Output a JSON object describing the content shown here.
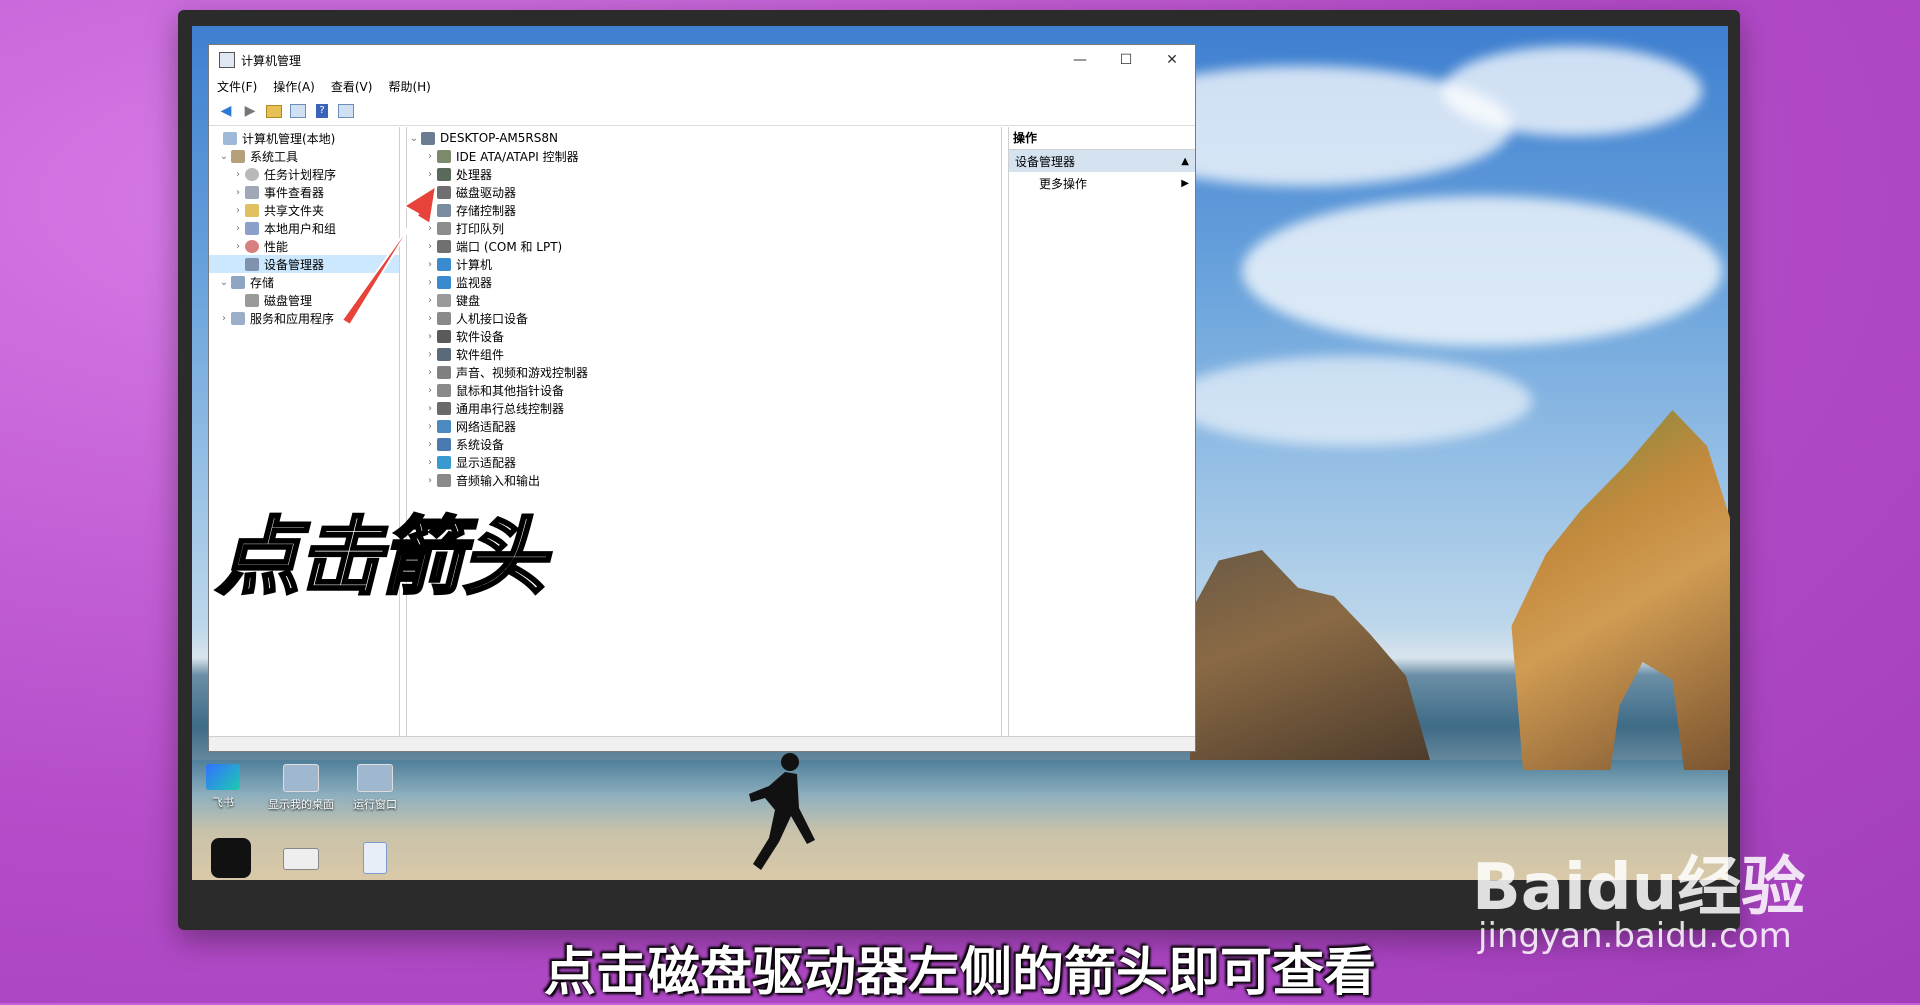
{
  "window": {
    "title": "计算机管理",
    "menu": [
      "文件(F)",
      "操作(A)",
      "查看(V)",
      "帮助(H)"
    ],
    "minimize_glyph": "—",
    "maximize_glyph": "☐",
    "close_glyph": "✕"
  },
  "tree": {
    "root": "计算机管理(本地)",
    "system_tools": "系统工具",
    "items": [
      "任务计划程序",
      "事件查看器",
      "共享文件夹",
      "本地用户和组",
      "性能",
      "设备管理器"
    ],
    "storage": "存储",
    "disk_mgmt": "磁盘管理",
    "services": "服务和应用程序"
  },
  "devices": {
    "computer_name": "DESKTOP-AM5RS8N",
    "categories": [
      "IDE ATA/ATAPI 控制器",
      "处理器",
      "磁盘驱动器",
      "存储控制器",
      "打印队列",
      "端口 (COM 和 LPT)",
      "计算机",
      "监视器",
      "键盘",
      "人机接口设备",
      "软件设备",
      "软件组件",
      "声音、视频和游戏控制器",
      "鼠标和其他指针设备",
      "通用串行总线控制器",
      "网络适配器",
      "系统设备",
      "显示适配器",
      "音频输入和输出"
    ]
  },
  "actions": {
    "header": "操作",
    "section": "设备管理器",
    "more": "更多操作"
  },
  "desktop_icons": [
    "飞书",
    "显示我的桌面",
    "运行窗口"
  ],
  "overlay": {
    "big_text": "点击箭头",
    "caption": "点击磁盘驱动器左侧的箭头即可查看"
  },
  "watermark": {
    "brand": "Baidu经验",
    "url": "jingyan.baidu.com"
  },
  "colors": {
    "selection": "#cce8ff",
    "arrow": "#e8433b",
    "background": "#c45fd6"
  }
}
